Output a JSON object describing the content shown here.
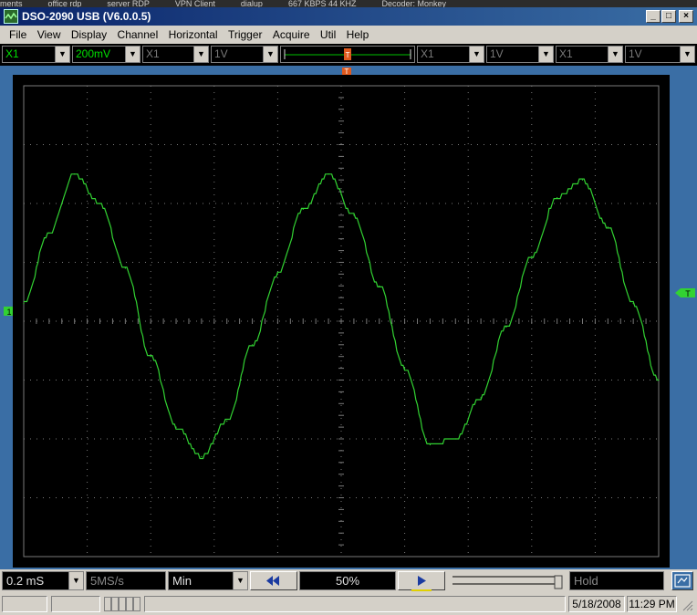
{
  "taskbar": {
    "items": [
      "ments",
      "office rdp",
      "server RDP",
      "VPN Client",
      "dialup",
      "667 KBPS  44 KHZ",
      "Decoder: Monkey"
    ]
  },
  "window": {
    "title": "DSO-2090 USB (V6.0.0.5)",
    "minimize_glyph": "_",
    "maximize_glyph": "□",
    "close_glyph": "×"
  },
  "menu": [
    "File",
    "View",
    "Display",
    "Channel",
    "Horizontal",
    "Trigger",
    "Acquire",
    "Util",
    "Help"
  ],
  "toolbar": {
    "ch1_probe": "X1",
    "ch1_volts": "200mV",
    "ch2_probe": "X1",
    "ch2_volts": "1V",
    "math_probe": "X1",
    "math_volts": "1V",
    "ref_probe": "X1",
    "ref_volts": "1V",
    "trigger_marker": "T",
    "trigger_position_percent": 50
  },
  "scope": {
    "channel_marker_left": "1",
    "trigger_level_marker": "T",
    "trace_color": "#32d232",
    "grid_color": "#7a7a7a",
    "divisions_x": 10,
    "divisions_y": 8
  },
  "chart_data": {
    "type": "line",
    "title": "",
    "xlabel": "",
    "ylabel": "",
    "xlim": [
      0,
      10
    ],
    "ylim": [
      -4,
      4
    ],
    "x_unit": "div",
    "y_unit": "div",
    "grid": true,
    "series": [
      {
        "x": [
          0,
          0.4,
          0.8,
          1.2,
          1.6,
          2.0,
          2.4,
          2.8,
          3.2,
          3.6,
          4.0,
          4.4,
          4.8,
          5.2,
          5.6,
          6.0,
          6.4,
          6.8,
          7.2,
          7.6,
          8.0,
          8.4,
          8.8,
          9.2,
          9.6,
          10.0
        ],
        "values": [
          0.3,
          1.5,
          2.5,
          2.0,
          0.9,
          -0.6,
          -1.8,
          -2.3,
          -1.7,
          -0.4,
          0.8,
          1.9,
          2.5,
          1.8,
          0.6,
          -0.8,
          -2.1,
          -2.0,
          -1.3,
          -0.1,
          1.1,
          2.1,
          2.4,
          1.6,
          0.3,
          -1.0
        ]
      }
    ]
  },
  "bottom": {
    "timebase": "0.2 mS",
    "sample_rate": "5MS/s",
    "mode": "Min",
    "horiz_position": "50%",
    "run_state": "Hold"
  },
  "status": {
    "date": "5/18/2008",
    "time": "11:29 PM"
  }
}
